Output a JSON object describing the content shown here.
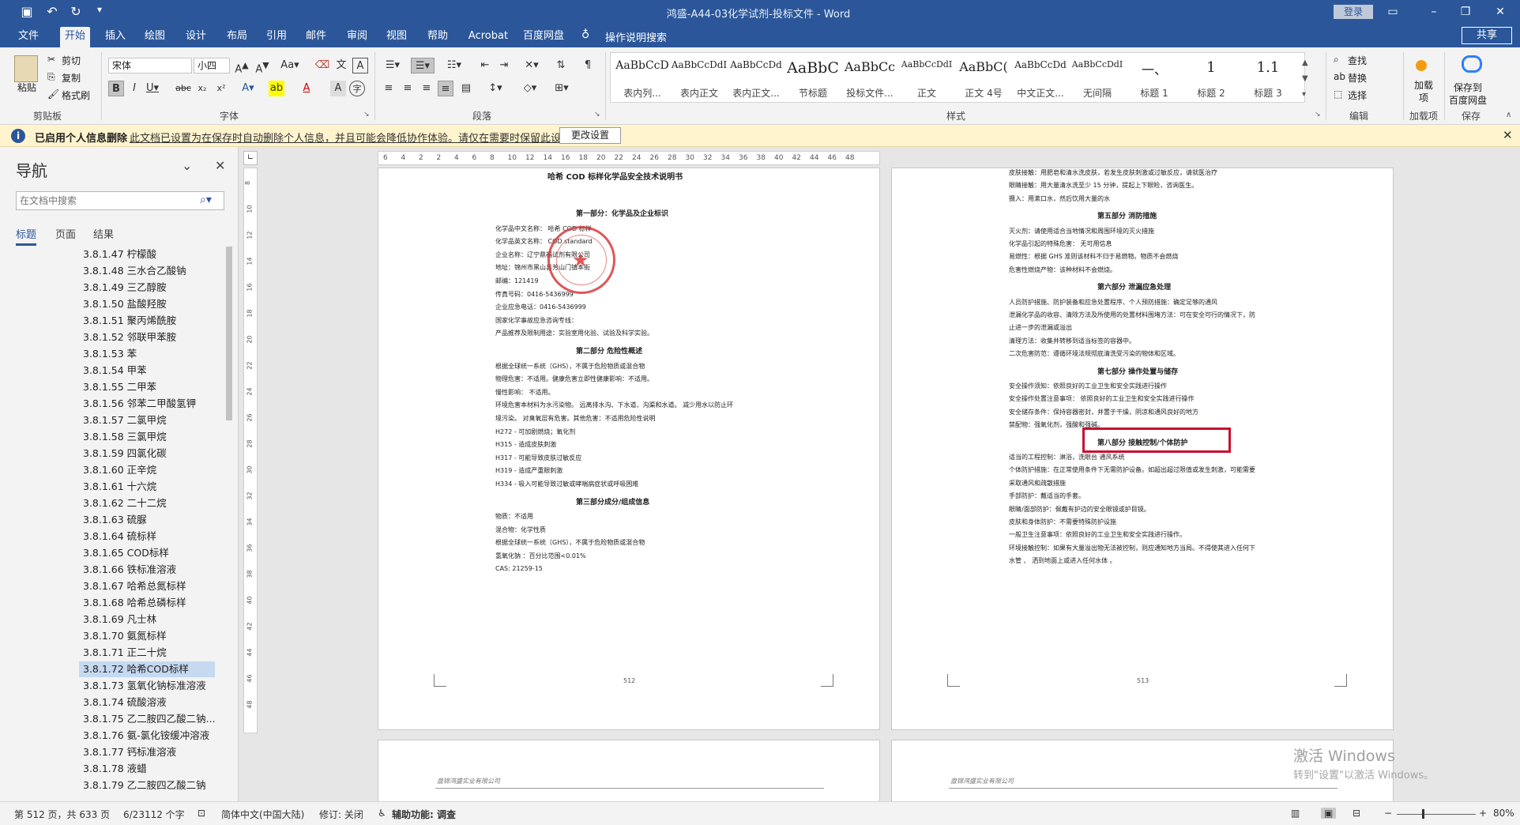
{
  "titlebar": {
    "title": "鸿盛-A44-03化学试剂-投标文件  -  Word",
    "login": "登录",
    "icons": [
      "save-icon",
      "undo-icon",
      "redo-icon",
      "customize-icon"
    ]
  },
  "tabs": [
    "文件",
    "开始",
    "插入",
    "绘图",
    "设计",
    "布局",
    "引用",
    "邮件",
    "审阅",
    "视图",
    "帮助",
    "Acrobat",
    "百度网盘"
  ],
  "tell_me": "操作说明搜索",
  "share": "共享",
  "ribbon": {
    "clipboard": {
      "paste": "粘贴",
      "cut": "剪切",
      "copy": "复制",
      "format_painter": "格式刷",
      "label": "剪贴板"
    },
    "font": {
      "name": "宋体",
      "size": "小四",
      "label": "字体"
    },
    "paragraph": {
      "label": "段落"
    },
    "styles": {
      "label": "样式",
      "items": [
        {
          "preview": "AaBbCcD",
          "name": "表内列..."
        },
        {
          "preview": "AaBbCcDdI",
          "name": "表内正文"
        },
        {
          "preview": "AaBbCcDd",
          "name": "表内正文..."
        },
        {
          "preview": "AaBbC",
          "name": "节标题"
        },
        {
          "preview": "AaBbCc",
          "name": "投标文件..."
        },
        {
          "preview": "AaBbCcDdI",
          "name": "正文"
        },
        {
          "preview": "AaBbC(",
          "name": "正文 4号"
        },
        {
          "preview": "AaBbCcDd",
          "name": "中文正文..."
        },
        {
          "preview": "AaBbCcDdI",
          "name": "无间隔"
        },
        {
          "preview": "一、",
          "name": "标题 1"
        },
        {
          "preview": "1",
          "name": "标题 2"
        },
        {
          "preview": "1.1",
          "name": "标题 3"
        }
      ]
    },
    "editing": {
      "find": "查找",
      "replace": "替换",
      "select": "选择",
      "label": "编辑"
    },
    "addins": {
      "btn": "加载项",
      "label": "加载项"
    },
    "baidu": {
      "btn1": "保存到",
      "btn2": "百度网盘",
      "label": "保存"
    }
  },
  "infobar": {
    "title": "已启用个人信息删除",
    "message": "此文档已设置为在保存时自动删除个人信息，并且可能会降低协作体验。请仅在需要时保留此设置。",
    "button": "更改设置"
  },
  "nav": {
    "title": "导航",
    "search_placeholder": "在文档中搜索",
    "tabs": [
      "标题",
      "页面",
      "结果"
    ],
    "items": [
      "3.8.1.47 柠檬酸",
      "3.8.1.48 三水合乙酸钠",
      "3.8.1.49 三乙醇胺",
      "3.8.1.50 盐酸羟胺",
      "3.8.1.51 聚丙烯酰胺",
      "3.8.1.52 邻联甲苯胺",
      "3.8.1.53 苯",
      "3.8.1.54 甲苯",
      "3.8.1.55 二甲苯",
      "3.8.1.56 邻苯二甲酸氢钾",
      "3.8.1.57 二氯甲烷",
      "3.8.1.58 三氯甲烷",
      "3.8.1.59 四氯化碳",
      "3.8.1.60 正辛烷",
      "3.8.1.61 十六烷",
      "3.8.1.62 二十二烷",
      "3.8.1.63 硫脲",
      "3.8.1.64 硫标样",
      "3.8.1.65 COD标样",
      "3.8.1.66 铁标准溶液",
      "3.8.1.67 哈希总氮标样",
      "3.8.1.68 哈希总磷标样",
      "3.8.1.69 凡士林",
      "3.8.1.70 氨氮标样",
      "3.8.1.71 正二十烷",
      "3.8.1.72 哈希COD标样",
      "3.8.1.73 氢氧化钠标准溶液",
      "3.8.1.74 硫酸溶液",
      "3.8.1.75 乙二胺四乙酸二钠...",
      "3.8.1.76 氨-氯化铵缓冲溶液",
      "3.8.1.77 钙标准溶液",
      "3.8.1.78 液蜡",
      "3.8.1.79 乙二胺四乙酸二钠"
    ],
    "selected_index": 25
  },
  "ruler": [
    "6",
    "4",
    "2",
    "2",
    "4",
    "6",
    "8",
    "10",
    "12",
    "14",
    "16",
    "18",
    "20",
    "22",
    "24",
    "26",
    "28",
    "30",
    "32",
    "34",
    "36",
    "38",
    "40",
    "42",
    "44",
    "46",
    "48"
  ],
  "vruler": [
    "8",
    "10",
    "12",
    "14",
    "16",
    "18",
    "20",
    "22",
    "24",
    "26",
    "28",
    "30",
    "32",
    "34",
    "36",
    "38",
    "40",
    "42",
    "44",
    "46",
    "48"
  ],
  "page_left": {
    "title": "哈希 COD 标样化学品安全技术说明书",
    "lines": [
      {
        "t": "第一部分：化学品及企业标识",
        "h": true
      },
      {
        "t": "化学品中文名称： 哈希 COD 标样",
        "h": false
      },
      {
        "t": "化学品英文名称： COD standard",
        "h": false
      },
      {
        "t": "企业名称：辽宁鼎福试剂有限公司",
        "h": false
      },
      {
        "t": "地址：锦州市黑山县芳山门镇本街",
        "h": false
      },
      {
        "t": "邮编：121419",
        "h": false
      },
      {
        "t": "传真号码：0416-5436999",
        "h": false
      },
      {
        "t": "企业应急电话：0416-5436999",
        "h": false
      },
      {
        "t": "国家化学事故应急咨询专线：",
        "h": false
      },
      {
        "t": "产品推荐及限制用途：实验室用化验、试验及科学实验。",
        "h": false
      },
      {
        "t": "第二部分 危险性概述",
        "h": true
      },
      {
        "t": "根据全球统一系统（GHS），不属于危险物质或混合物",
        "h": false
      },
      {
        "t": "物理危害：不适用。健康危害立即性健康影响：不适用。",
        "h": false
      },
      {
        "t": "慢性影响： 不适用。",
        "h": false
      },
      {
        "t": "环境危害本材料为水污染物。 远离排水沟、下水道、沟渠和水道。 减少用水以防止环",
        "h": false
      },
      {
        "t": "境污染。 对臭氧层有危害。其他危害：不适用危险性说明",
        "h": false
      },
      {
        "t": "H272 - 可加剧燃烧；氧化剂",
        "h": false
      },
      {
        "t": "H315 - 造成皮肤刺激",
        "h": false
      },
      {
        "t": "H317 - 可能导致皮肤过敏反应",
        "h": false
      },
      {
        "t": "H319 - 造成严重眼刺激",
        "h": false
      },
      {
        "t": "H334 - 吸入可能导致过敏或哮喘病症状或呼吸困难",
        "h": false
      },
      {
        "t": "第三部分成分/组成信息",
        "h": true
      },
      {
        "t": "物质：不适用",
        "h": false
      },
      {
        "t": "混合物：化学性质",
        "h": false
      },
      {
        "t": "根据全球统一系统（GHS），不属于危险物质或混合物",
        "h": false
      },
      {
        "t": "氢氧化钠    ：百分比范围<0.01%",
        "h": false
      },
      {
        "t": "CAS: 21259-15",
        "h": false
      }
    ],
    "page_number": "512"
  },
  "page_right": {
    "lines": [
      {
        "t": "皮肤接触：用肥皂和清水洗皮肤，若发生皮肤刺激或过敏反应，请就医治疗",
        "h": false
      },
      {
        "t": "眼睛接触：用大量清水洗至少 15 分钟，提起上下眼睑，咨询医生。",
        "h": false
      },
      {
        "t": "摄入：用漱口水，然后饮用大量的水",
        "h": false
      },
      {
        "t": "第五部分 消防措施",
        "h": true
      },
      {
        "t": "灭火剂：请使用适合当地情况和周围环境的灭火措施",
        "h": false
      },
      {
        "t": "化学品引起的特殊危害：  无可用信息",
        "h": false
      },
      {
        "t": "易燃性：根据 GHS 准则该材料不归于易燃物。物质不会燃烧",
        "h": false
      },
      {
        "t": "危害性燃烧产物：该种材料不会燃烧。",
        "h": false
      },
      {
        "t": "第六部分 泄漏应急处理",
        "h": true
      },
      {
        "t": "人员防护措施、防护装备和应急处置程序、个人预防措施：确定足够的通风",
        "h": false
      },
      {
        "t": "泄漏化学品的收容、清除方法及所使用的处置材料围堵方法：可在安全可行的情况下，防",
        "h": false
      },
      {
        "t": "止进一步的泄漏或溢出",
        "h": false
      },
      {
        "t": "清理方法：收集并转移到适当标签的容器中。",
        "h": false
      },
      {
        "t": "二次危害防范：遵循环境法规彻底清洗受污染的物体和区域。",
        "h": false
      },
      {
        "t": "第七部分 操作处置与储存",
        "h": true
      },
      {
        "t": "安全操作须知：依照良好的工业卫生和安全实践进行操作",
        "h": false
      },
      {
        "t": "安全操作处置注意事项： 依照良好的工业卫生和安全实践进行操作",
        "h": false
      },
      {
        "t": "安全储存条件：保持容器密封，并置于干燥，阴凉和通风良好的地方",
        "h": false
      },
      {
        "t": "禁配物：强氧化剂，强酸和强碱。",
        "h": false
      },
      {
        "t": "第八部分 接触控制/个体防护",
        "h": true
      },
      {
        "t": "适当的工程控制：淋浴，洗眼台 通风系统",
        "h": false
      },
      {
        "t": "个体防护措施：在正常使用条件下无需防护设备。如超出超过限值或发生刺激，可能需要",
        "h": false
      },
      {
        "t": "采取通风和疏散措施",
        "h": false
      },
      {
        "t": "手部防护：戴适当的手套。",
        "h": false
      },
      {
        "t": "眼睛/面部防护：佩戴有护边的安全眼镜或护目镜。",
        "h": false
      },
      {
        "t": "皮肤和身体防护：不需要特殊防护设施",
        "h": false
      },
      {
        "t": "一般卫生注意事项：依照良好的工业卫生和安全实践进行操作。",
        "h": false
      },
      {
        "t": "环境接触控制：如果有大量溢出物无法被控制，则应通知地方当局。不得使其进入任何下",
        "h": false
      },
      {
        "t": "水管 、 洒到地面上或进入任何水体 。",
        "h": false
      }
    ],
    "page_number": "513"
  },
  "header_text": "盘锦鸿盛实业有限公司",
  "status": {
    "page": "第 512 页，共 633 页",
    "words": "6/23112 个字",
    "lang": "简体中文(中国大陆)",
    "track": "修订: 关闭",
    "access": "辅助功能: 调查",
    "zoom": "80%"
  },
  "activation": {
    "line1": "激活 Windows",
    "line2": "转到\"设置\"以激活 Windows。"
  }
}
